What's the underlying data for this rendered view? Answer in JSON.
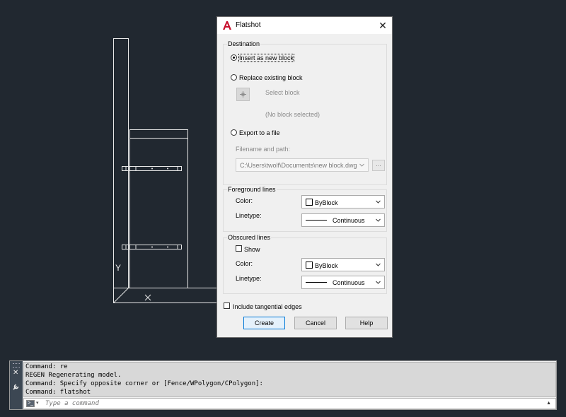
{
  "canvas": {
    "axis_y": "Y",
    "axis_x": "X"
  },
  "dialog": {
    "title": "Flatshot",
    "close_glyph": "✕",
    "destination": {
      "label": "Destination",
      "insert_new": "Insert as new block",
      "replace_existing": "Replace existing block",
      "select_block": "Select block",
      "no_block": "(No block selected)",
      "export_file": "Export to a file",
      "filename_label": "Filename and path:",
      "filename_value": "C:\\Users\\twolf\\Documents\\new block.dwg",
      "browse": "..."
    },
    "foreground": {
      "label": "Foreground lines",
      "color_label": "Color:",
      "color_value": "ByBlock",
      "linetype_label": "Linetype:",
      "linetype_value": "Continuous"
    },
    "obscured": {
      "label": "Obscured lines",
      "show_label": "Show",
      "color_label": "Color:",
      "color_value": "ByBlock",
      "linetype_label": "Linetype:",
      "linetype_value": "Continuous"
    },
    "include_tangential": "Include tangential edges",
    "buttons": {
      "create": "Create",
      "cancel": "Cancel",
      "help": "Help"
    }
  },
  "command_line": {
    "history": [
      "Command: re",
      "REGEN Regenerating model.",
      "Command: Specify opposite corner or [Fence/WPolygon/CPolygon]:",
      "Command: flatshot"
    ],
    "placeholder": "Type a command",
    "close_glyph": "✕",
    "prompt_glyph": ">_",
    "prompt_chevron": "▾",
    "scroll_glyph": "▲"
  },
  "colors": {
    "canvas_bg": "#212830",
    "dialog_bg": "#f0f0f0",
    "accent": "#0078d7",
    "app_icon": "#c8102e"
  }
}
